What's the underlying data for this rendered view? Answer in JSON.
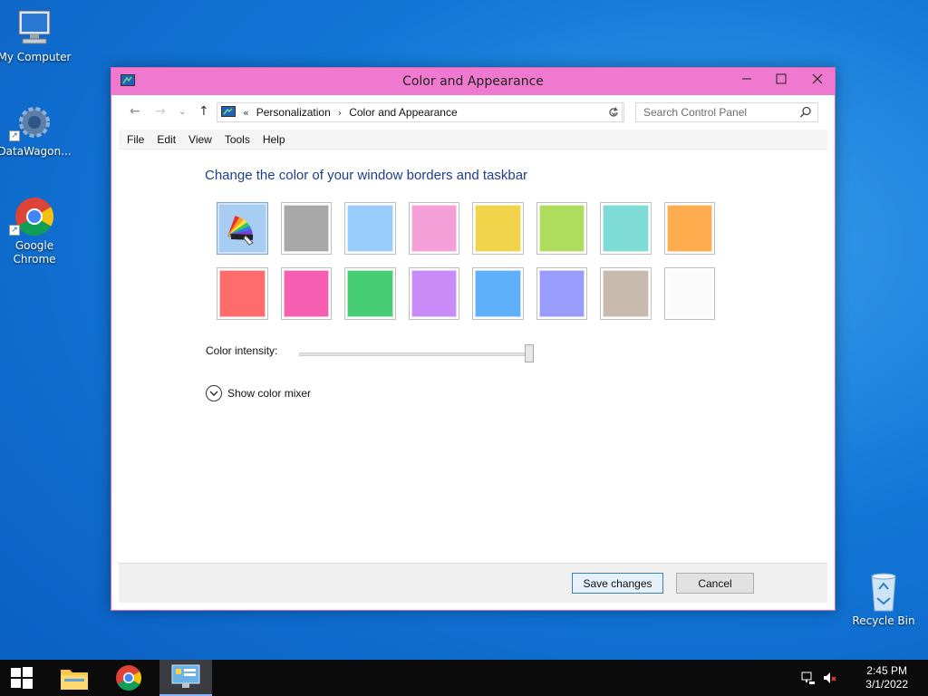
{
  "desktop": {
    "icons": [
      {
        "label": "My Computer"
      },
      {
        "label": "DataWagon..."
      },
      {
        "label": "Google Chrome"
      },
      {
        "label": "Recycle Bin"
      }
    ]
  },
  "window": {
    "title": "Color and Appearance",
    "accent_color": "#ef79cf",
    "address": {
      "prefix": "«",
      "crumbs": [
        "Personalization",
        "Color and Appearance"
      ]
    },
    "search": {
      "placeholder": "Search Control Panel"
    },
    "menu": [
      "File",
      "Edit",
      "View",
      "Tools",
      "Help"
    ],
    "heading": "Change the color of your window borders and taskbar",
    "swatches": [
      {
        "name": "automatic",
        "color": "#a8cdf3",
        "selected": true
      },
      {
        "name": "gray",
        "color": "#a8a8a8"
      },
      {
        "name": "light-blue",
        "color": "#98cdfb"
      },
      {
        "name": "pink",
        "color": "#f59fd8"
      },
      {
        "name": "yellow",
        "color": "#f1d44a"
      },
      {
        "name": "green",
        "color": "#aedc5d"
      },
      {
        "name": "teal",
        "color": "#7fdbd6"
      },
      {
        "name": "orange",
        "color": "#ffac4f"
      },
      {
        "name": "red",
        "color": "#ff6c6c"
      },
      {
        "name": "magenta",
        "color": "#f55eb1"
      },
      {
        "name": "emerald",
        "color": "#47cd74"
      },
      {
        "name": "violet",
        "color": "#c88bf7"
      },
      {
        "name": "blue",
        "color": "#5fb0fb"
      },
      {
        "name": "periwinkle",
        "color": "#999cfb"
      },
      {
        "name": "taupe",
        "color": "#c8bbad"
      },
      {
        "name": "white",
        "color": "#fbfbfb"
      }
    ],
    "intensity": {
      "label": "Color intensity:",
      "value_percent": 100
    },
    "mixer_label": "Show color mixer",
    "buttons": {
      "save": "Save changes",
      "cancel": "Cancel"
    }
  },
  "taskbar": {
    "clock_time": "2:45 PM",
    "clock_date": "3/1/2022"
  }
}
